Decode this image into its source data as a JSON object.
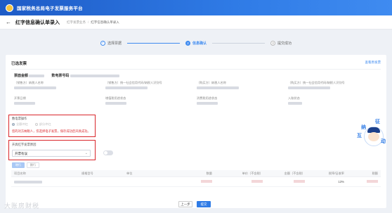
{
  "app": {
    "title": "国家税务总局电子发票服务平台"
  },
  "header": {
    "page_title": "红字信息确认单录入",
    "breadcrumb": [
      "红字发票业务",
      "红字信息确认单录入"
    ]
  },
  "steps": [
    {
      "index": "1",
      "label": "选择票据"
    },
    {
      "index": "2",
      "label": "信息确认"
    },
    {
      "index": "3",
      "label": "提交成功"
    }
  ],
  "invoice_section": {
    "title": "已选发票",
    "view_link": "查看原发票",
    "amount_label": "票面金额",
    "number_label": "数电票号码",
    "fields": [
      "（销售方）纳税人名称",
      "（销售方）统一社会信用代码/纳税人识别号",
      "（购买方）纳税人名称",
      "（购买方）统一社会信用代码/纳税人识别号",
      "开票日期",
      "增值税用途状态",
      "消费税用途状态",
      "入账状态"
    ]
  },
  "red_type": {
    "label": "数电票操作",
    "options": [
      "全额冲红",
      "部分冲红"
    ],
    "notice": "您的对方纳税人，仅选择电子发票，保存成功后开具成功。"
  },
  "reason": {
    "label": "开具红字发票原因",
    "selected": "开票有误"
  },
  "buttons": {
    "add": "增行",
    "delete": "删行",
    "prev": "上一步",
    "submit": "提交"
  },
  "table": {
    "headers": [
      "项目名称",
      "规格型号",
      "单位",
      "数量",
      "单价（不含税）",
      "金额（不含税）",
      "税率/征收率",
      "税额"
    ],
    "rows": [
      {
        "tax_rate": "13%"
      }
    ]
  },
  "watermark": "大账房财税",
  "mascot": {
    "chars": [
      "征",
      "纳",
      "互",
      "动"
    ]
  }
}
